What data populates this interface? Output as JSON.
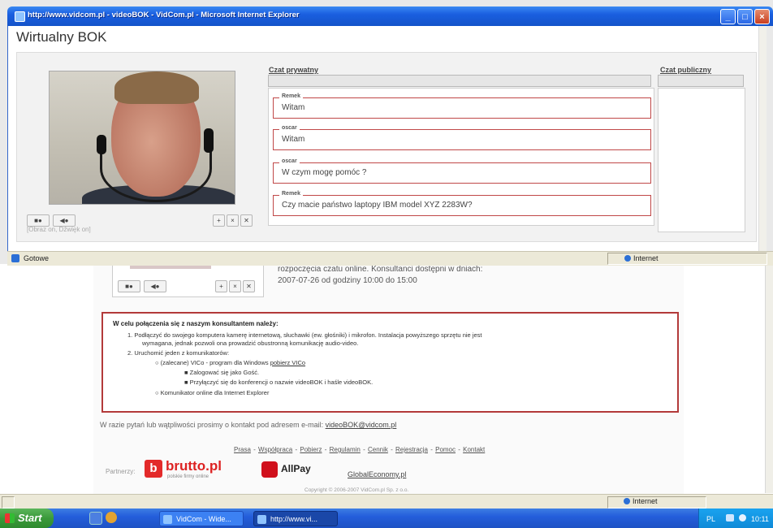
{
  "background_window": {
    "info_text_line1": "rozpoczęcia czatu online. Konsultanci dostępni w dniach:",
    "info_text_line2": "2007-07-26 od godziny 10:00 do 15:00",
    "instructions": {
      "heading": "W celu połączenia się z naszym konsultantem należy:",
      "step1": "1.   Podłączyć do swojego komputera kamerę internetową, słuchawki (ew. głośniki) i mikrofon. Instalacja powyższego sprzętu nie jest",
      "step1b": "wymagana, jednak pozwoli ona prowadzić obustronną komunikację audio-video.",
      "step2": "2.   Uruchomić jeden z komunikatorów:",
      "option1_prefix": "(zalecane) VICo - program dla Windows",
      "option1_link": "pobierz VICo",
      "sub1": "Zalogować się jako Gość.",
      "sub2": "Przyłączyć się do konferencji o nazwie videoBOK i haśle videoBOK.",
      "option2": "Komunikator online dla Internet Explorer"
    },
    "contact_text": "W razie pytań lub wątpliwości prosimy o kontakt pod adresem e-mail:",
    "contact_email": "videoBOK@vidcom.pl",
    "footer_links": [
      "Prasa",
      "Współpraca",
      "Pobierz",
      "Regulamin",
      "Cennik",
      "Rejestracja",
      "Pomoc",
      "Kontakt"
    ],
    "partners_label": "Partnerzy:",
    "partners": {
      "brutto_name": "brutto.pl",
      "brutto_tagline": "polskie firmy online",
      "allpay_name": "AllPay",
      "global": "GlobalEconomy.pl"
    },
    "copyright": "Copyright © 2006-2007 VidCom.pl Sp. z o.o.",
    "status_zone": "Internet"
  },
  "popup": {
    "title": "http://www.vidcom.pl - videoBOK - VidCom.pl - Microsoft Internet Explorer",
    "heading": "Wirtualny BOK",
    "video_status": "[Obraz on, Dźwięk on]",
    "private_chat_label": "Czat prywatny",
    "public_chat_label": "Czat publiczny",
    "messages": [
      {
        "author": "Remek",
        "text": "Witam"
      },
      {
        "author": "oscar",
        "text": "Witam"
      },
      {
        "author": "oscar",
        "text": "W czym mogę pomóc ?"
      },
      {
        "author": "Remek",
        "text": "Czy macie państwo laptopy IBM model XYZ 2283W?"
      }
    ],
    "status_left": "Gotowe",
    "status_zone": "Internet",
    "controls": {
      "video_btn": "■●",
      "audio_btn": "◀●",
      "small1": "+",
      "small2": "×",
      "small3": "✕"
    }
  },
  "window_buttons": {
    "minimize": "_",
    "maximize": "□",
    "close": "×"
  },
  "taskbar": {
    "start": "Start",
    "tasks": [
      "VidCom - Wide...",
      "http://www.vi..."
    ],
    "language": "PL",
    "clock": "10:11"
  },
  "colors": {
    "accent_red": "#b33a3a",
    "xp_blue": "#245edb",
    "start_green": "#3b9a3b"
  }
}
